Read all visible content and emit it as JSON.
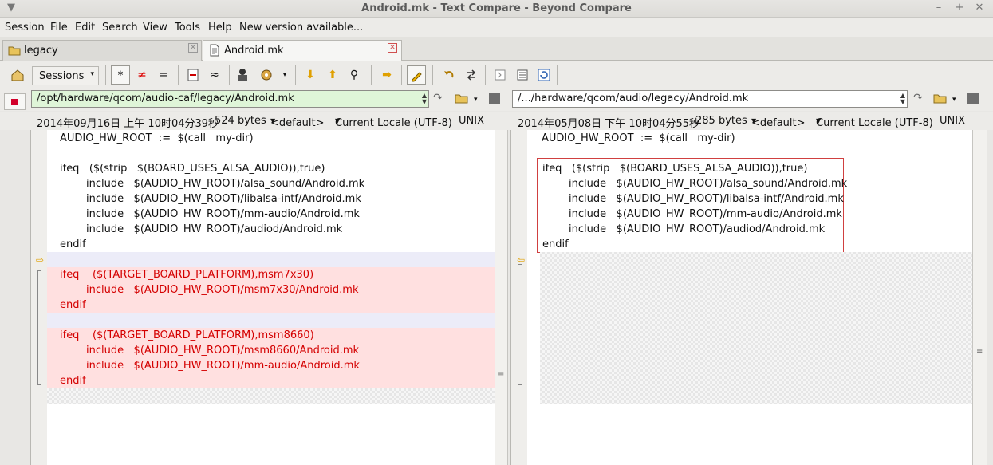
{
  "window": {
    "title": "Android.mk - Text Compare - Beyond Compare",
    "menu_glyph": "▼",
    "min_glyph": "–",
    "max_glyph": "+",
    "close_glyph": "✕"
  },
  "menu": {
    "session": "Session",
    "file": "File",
    "edit": "Edit",
    "search": "Search",
    "view": "View",
    "tools": "Tools",
    "help": "Help",
    "new_version": "New version available..."
  },
  "tabs": [
    {
      "label": "legacy",
      "icon": "folder-icon"
    },
    {
      "label": "Android.mk",
      "icon": "document-icon"
    }
  ],
  "toolbar": {
    "sessions_label": "Sessions",
    "dropdown_glyph": "▾",
    "all_glyph": "*",
    "diffs_glyph": "≠",
    "same_glyph": "=",
    "context_glyph": "≈",
    "next_glyph": "⬇",
    "prev_glyph": "⬆",
    "find_glyph": "⚲",
    "copy_glyph": "➡"
  },
  "left": {
    "path": "/opt/hardware/qcom/audio-caf/legacy/Android.mk",
    "date": "2014年09月16日 上午 10时04分39秒",
    "size": "524 bytes",
    "format": "<default>",
    "encoding": "Current Locale (UTF-8)",
    "line_endings": "UNIX",
    "lines": [
      "AUDIO_HW_ROOT  :=  $(call   my-dir)",
      "",
      "ifeq   ($(strip   $(BOARD_USES_ALSA_AUDIO)),true)",
      "        include   $(AUDIO_HW_ROOT)/alsa_sound/Android.mk",
      "        include   $(AUDIO_HW_ROOT)/libalsa-intf/Android.mk",
      "        include   $(AUDIO_HW_ROOT)/mm-audio/Android.mk",
      "        include   $(AUDIO_HW_ROOT)/audiod/Android.mk",
      "endif",
      "",
      "ifeq    ($(TARGET_BOARD_PLATFORM),msm7x30)",
      "        include   $(AUDIO_HW_ROOT)/msm7x30/Android.mk",
      "endif",
      "",
      "ifeq    ($(TARGET_BOARD_PLATFORM),msm8660)",
      "        include   $(AUDIO_HW_ROOT)/msm8660/Android.mk",
      "        include   $(AUDIO_HW_ROOT)/mm-audio/Android.mk",
      "endif"
    ]
  },
  "right": {
    "path": "/.../hardware/qcom/audio/legacy/Android.mk",
    "date": "2014年05月08日 下午 10时04分55秒",
    "size": "285 bytes",
    "format": "<default>",
    "encoding": "Current Locale (UTF-8)",
    "line_endings": "UNIX",
    "lines": [
      "AUDIO_HW_ROOT  :=  $(call   my-dir)",
      "",
      "ifeq   ($(strip   $(BOARD_USES_ALSA_AUDIO)),true)",
      "        include   $(AUDIO_HW_ROOT)/alsa_sound/Android.mk",
      "        include   $(AUDIO_HW_ROOT)/libalsa-intf/Android.mk",
      "        include   $(AUDIO_HW_ROOT)/mm-audio/Android.mk",
      "        include   $(AUDIO_HW_ROOT)/audiod/Android.mk",
      "endif"
    ]
  },
  "colors": {
    "diff_text": "#d40000",
    "diff_bg": "#ffe0e0",
    "left_path_bg": "#dff5d8",
    "right_path_bg": "#ffffff"
  }
}
